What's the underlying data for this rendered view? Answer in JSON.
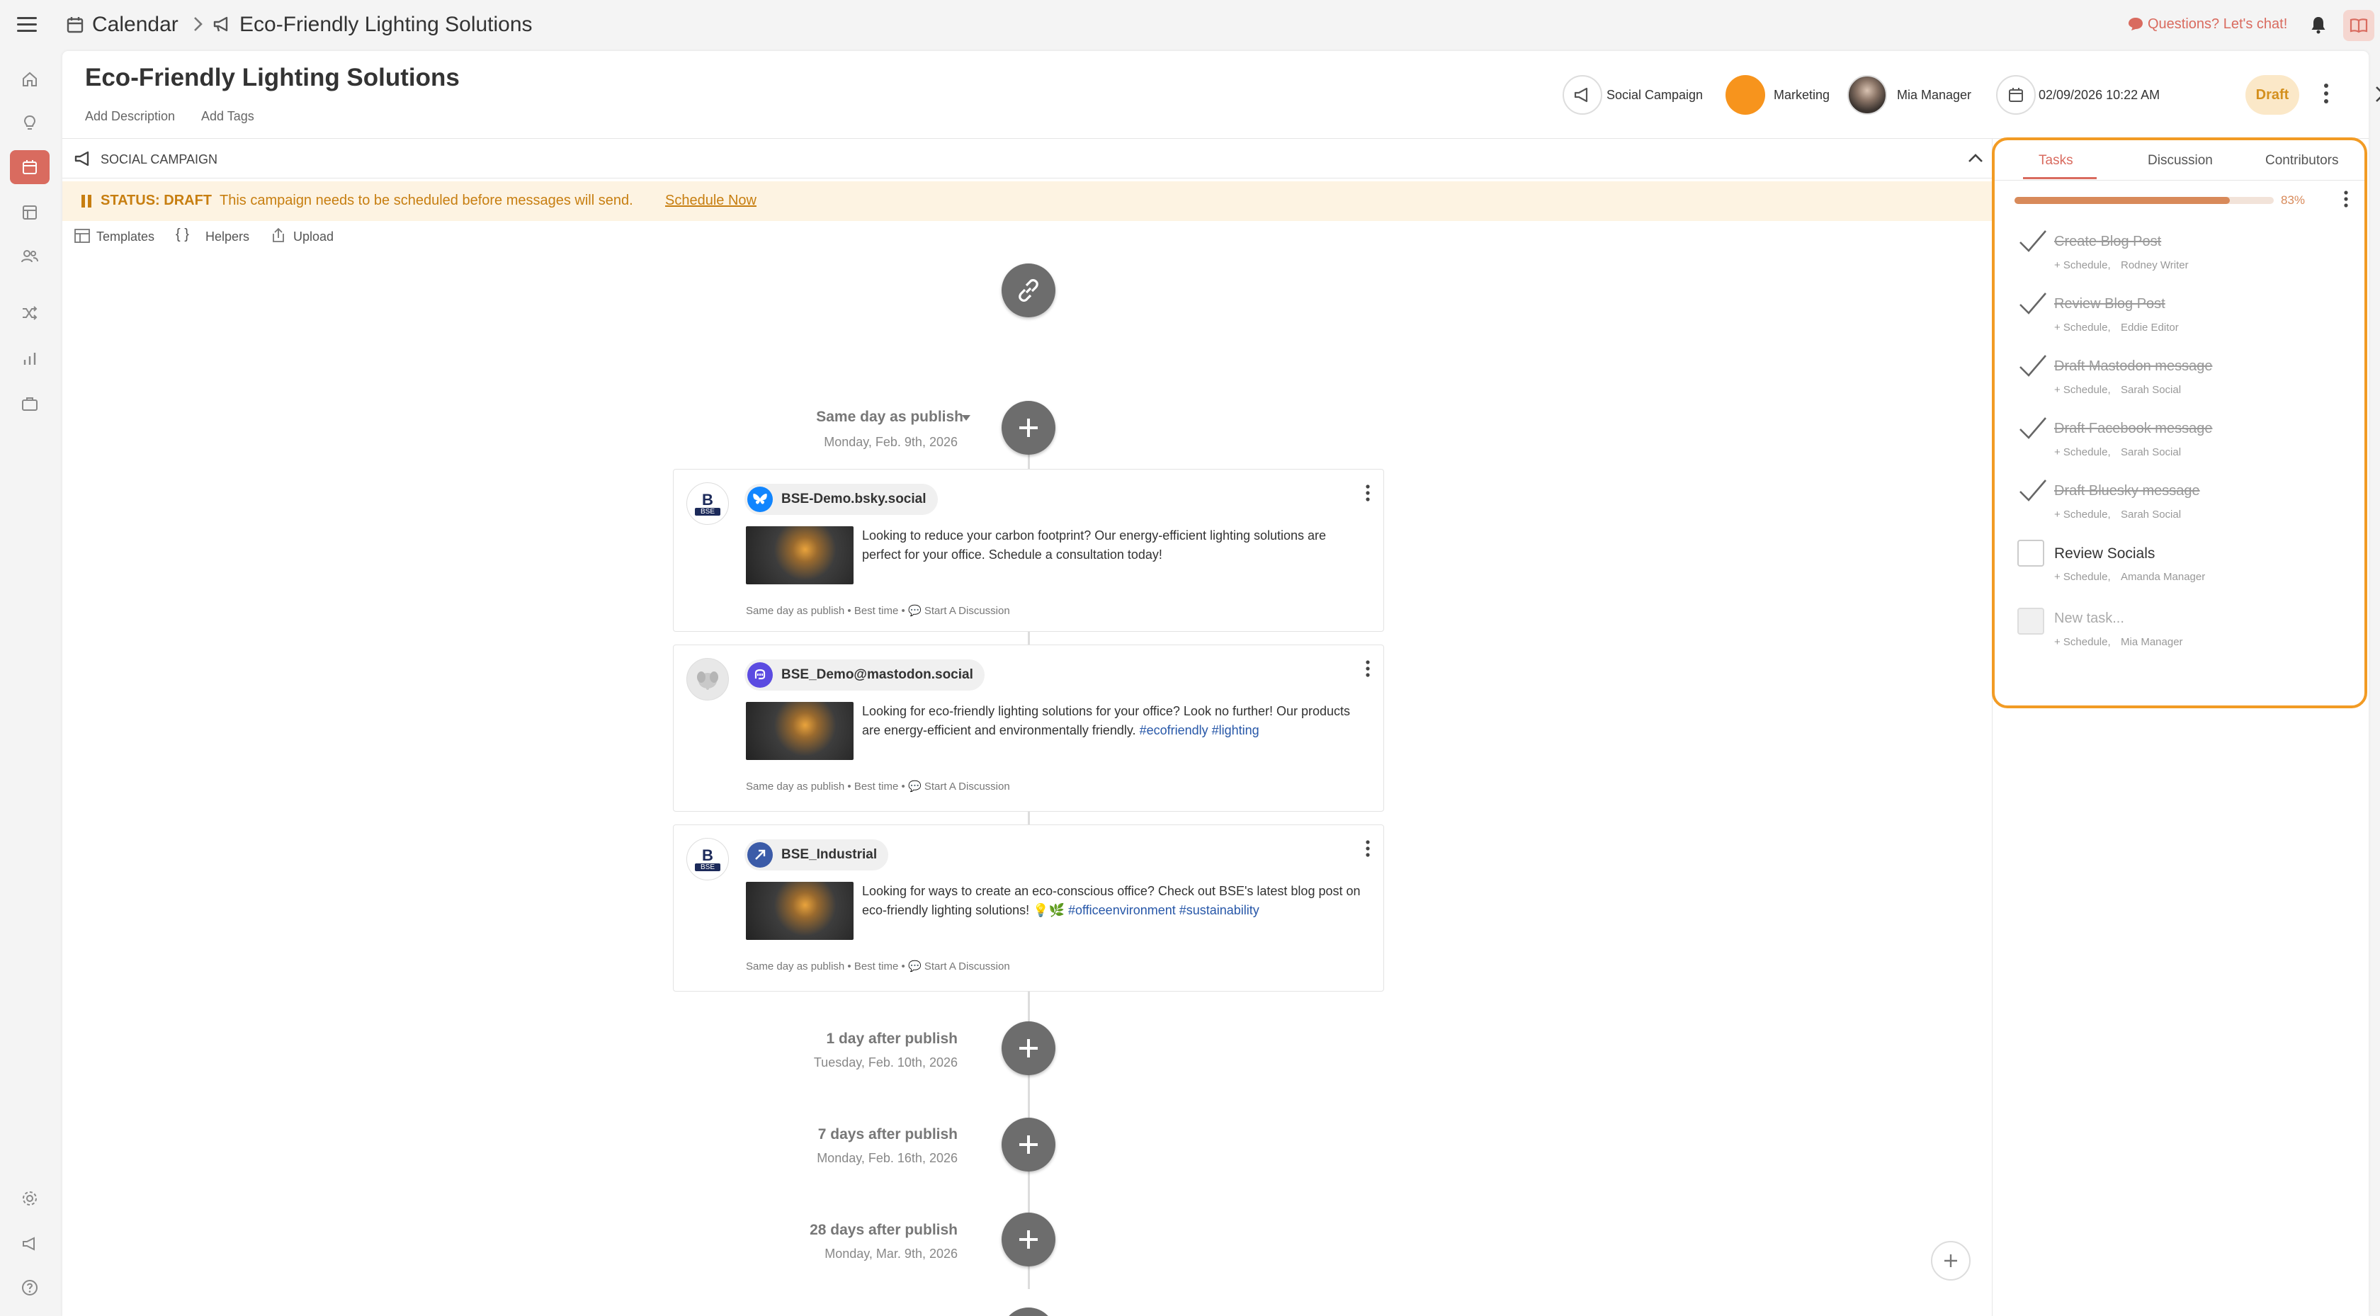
{
  "breadcrumb": {
    "root": "Calendar",
    "current": "Eco-Friendly Lighting Solutions"
  },
  "topbar": {
    "chat_label": "Questions? Let's chat!"
  },
  "header": {
    "title": "Eco-Friendly Lighting Solutions",
    "add_description": "Add Description",
    "add_tags": "Add Tags",
    "type_label": "Social Campaign",
    "team_label": "Marketing",
    "owner_label": "Mia Manager",
    "date_label": "02/09/2026 10:22 AM",
    "status_pill": "Draft"
  },
  "section": {
    "title": "SOCIAL CAMPAIGN"
  },
  "status_bar": {
    "label": "STATUS: DRAFT",
    "message": "This campaign needs to be scheduled before messages will send.",
    "action": "Schedule Now"
  },
  "toolbar": {
    "templates": "Templates",
    "helpers": "Helpers",
    "upload": "Upload"
  },
  "timeline": {
    "groups": [
      {
        "title": "Same day as publish",
        "date": "Monday, Feb. 9th, 2026"
      },
      {
        "title": "1 day after publish",
        "date": "Tuesday, Feb. 10th, 2026"
      },
      {
        "title": "7 days after publish",
        "date": "Monday, Feb. 16th, 2026"
      },
      {
        "title": "28 days after publish",
        "date": "Monday, Mar. 9th, 2026"
      }
    ]
  },
  "messages": [
    {
      "account": "BSE-Demo.bsky.social",
      "text": "Looking to reduce your carbon footprint? Our energy-efficient lighting solutions are perfect for your office. Schedule a consultation today!",
      "tags": "",
      "footer_timing": "Same day as publish • Best time •",
      "discussion": "Start A Discussion",
      "network_color": "#1185fe"
    },
    {
      "account": "BSE_Demo@mastodon.social",
      "text": "Looking for eco-friendly lighting solutions for your office? Look no further! Our products are energy-efficient and environmentally friendly.",
      "tags": "#ecofriendly #lighting",
      "footer_timing": "Same day as publish • Best time •",
      "discussion": "Start A Discussion",
      "network_color": "#5b4be1"
    },
    {
      "account": "BSE_Industrial",
      "text": "Looking for ways to create an eco-conscious office? Check out BSE's latest blog post on eco-friendly lighting solutions! 💡🌿",
      "tags": "#officeenvironment #sustainability",
      "footer_timing": "Same day as publish • Best time •",
      "discussion": "Start A Discussion",
      "network_color": "#3b5ba8"
    }
  ],
  "avatar_logo": {
    "letter": "B",
    "sub": "BSE"
  },
  "tasks_panel": {
    "tabs": [
      "Tasks",
      "Discussion",
      "Contributors"
    ],
    "progress": 0.83,
    "progress_label": "83%",
    "accent": "#d88a5a",
    "items": [
      {
        "title": "Create Blog Post",
        "schedule": "+ Schedule,",
        "assignee": "Rodney Writer",
        "done": true
      },
      {
        "title": "Review Blog Post",
        "schedule": "+ Schedule,",
        "assignee": "Eddie Editor",
        "done": true
      },
      {
        "title": "Draft Mastodon message",
        "schedule": "+ Schedule,",
        "assignee": "Sarah Social",
        "done": true
      },
      {
        "title": "Draft Facebook message",
        "schedule": "+ Schedule,",
        "assignee": "Sarah Social",
        "done": true
      },
      {
        "title": "Draft Bluesky message",
        "schedule": "+ Schedule,",
        "assignee": "Sarah Social",
        "done": true
      },
      {
        "title": "Review Socials",
        "schedule": "+ Schedule,",
        "assignee": "Amanda Manager",
        "done": false
      }
    ],
    "new_task": {
      "placeholder": "New task...",
      "schedule": "+ Schedule,",
      "assignee": "Mia Manager"
    }
  },
  "colors": {
    "accent_red": "#d96b5f",
    "highlight_orange": "#f29b24",
    "status_text": "#c77e10",
    "team_dot": "#f7941d"
  }
}
